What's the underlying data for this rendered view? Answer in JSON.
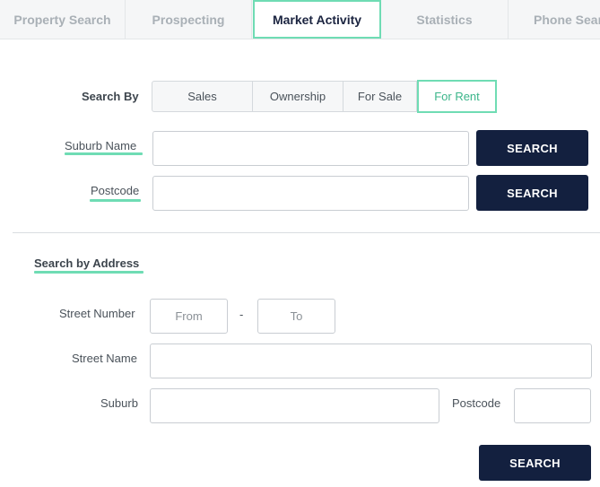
{
  "tabs": [
    {
      "label": "Property Search",
      "active": false
    },
    {
      "label": "Prospecting",
      "active": false
    },
    {
      "label": "Market Activity",
      "active": true
    },
    {
      "label": "Statistics",
      "active": false
    },
    {
      "label": "Phone Search",
      "active": false
    }
  ],
  "search_by": {
    "label": "Search By",
    "options": [
      "Sales",
      "Ownership",
      "For Sale",
      "For Rent"
    ],
    "selected": "For Rent"
  },
  "suburb_search": {
    "label": "Suburb Name",
    "value": "",
    "button": "SEARCH"
  },
  "postcode_search": {
    "label": "Postcode",
    "value": "",
    "button": "SEARCH"
  },
  "address_search": {
    "heading": "Search by Address",
    "street_number_label": "Street Number",
    "from_placeholder": "From",
    "range_separator": "-",
    "to_placeholder": "To",
    "street_name_label": "Street Name",
    "suburb_label": "Suburb",
    "postcode_label": "Postcode",
    "button": "SEARCH"
  },
  "colors": {
    "accent": "#6fdcb4",
    "accent_text": "#3bb58a",
    "button_bg": "#13203f",
    "tab_bg": "#f5f6f7"
  }
}
